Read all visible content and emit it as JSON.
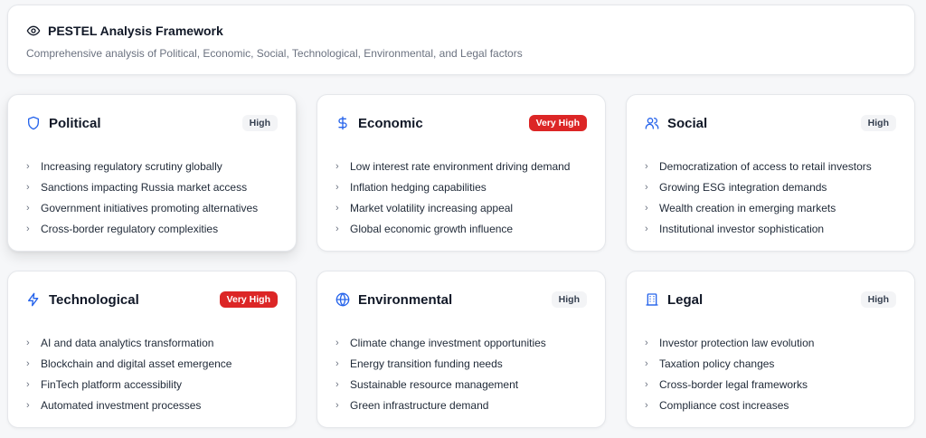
{
  "header": {
    "title": "PESTEL Analysis Framework",
    "subtitle": "Comprehensive analysis of Political, Economic, Social, Technological, Environmental, and Legal factors",
    "icon": "eye-icon"
  },
  "colors": {
    "accent": "#2563eb",
    "very_high_badge": "#dc2626",
    "high_badge": "#f3f4f6"
  },
  "cards": [
    {
      "title": "Political",
      "icon": "shield-icon",
      "impact": "High",
      "items": [
        "Increasing regulatory scrutiny globally",
        "Sanctions impacting Russia market access",
        "Government initiatives promoting alternatives",
        "Cross-border regulatory complexities"
      ]
    },
    {
      "title": "Economic",
      "icon": "dollar-icon",
      "impact": "Very High",
      "items": [
        "Low interest rate environment driving demand",
        "Inflation hedging capabilities",
        "Market volatility increasing appeal",
        "Global economic growth influence"
      ]
    },
    {
      "title": "Social",
      "icon": "users-icon",
      "impact": "High",
      "items": [
        "Democratization of access to retail investors",
        "Growing ESG integration demands",
        "Wealth creation in emerging markets",
        "Institutional investor sophistication"
      ]
    },
    {
      "title": "Technological",
      "icon": "lightning-icon",
      "impact": "Very High",
      "items": [
        "AI and data analytics transformation",
        "Blockchain and digital asset emergence",
        "FinTech platform accessibility",
        "Automated investment processes"
      ]
    },
    {
      "title": "Environmental",
      "icon": "globe-icon",
      "impact": "High",
      "items": [
        "Climate change investment opportunities",
        "Energy transition funding needs",
        "Sustainable resource management",
        "Green infrastructure demand"
      ]
    },
    {
      "title": "Legal",
      "icon": "building-icon",
      "impact": "High",
      "items": [
        "Investor protection law evolution",
        "Taxation policy changes",
        "Cross-border legal frameworks",
        "Compliance cost increases"
      ]
    }
  ]
}
